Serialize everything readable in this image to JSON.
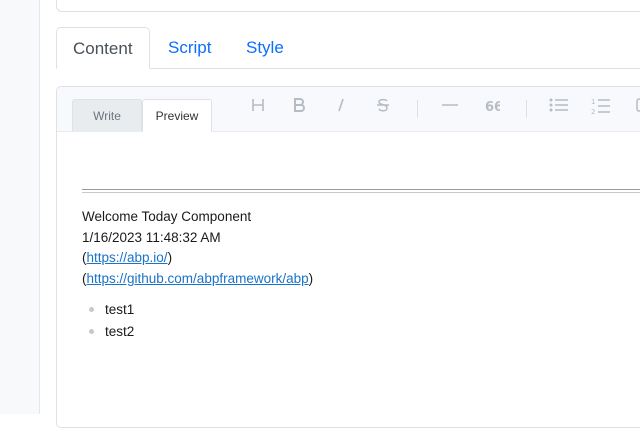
{
  "tabs": [
    {
      "label": "Content",
      "active": true
    },
    {
      "label": "Script",
      "active": false
    },
    {
      "label": "Style",
      "active": false
    }
  ],
  "editor": {
    "modes": [
      {
        "label": "Write",
        "active": false
      },
      {
        "label": "Preview",
        "active": true
      }
    ],
    "toolbar_icons": [
      "heading-icon",
      "bold-icon",
      "italic-icon",
      "strikethrough-icon",
      "horizontal-rule-icon",
      "quote-icon",
      "bullet-list-icon",
      "ordered-list-icon",
      "task-list-icon"
    ]
  },
  "preview": {
    "title": "Welcome Today Component",
    "datetime": "1/16/2023 11:48:32 AM",
    "links": [
      {
        "open": "(",
        "url": "https://abp.io/",
        "close": ")"
      },
      {
        "open": "(",
        "url": "https://github.com/abpframework/abp",
        "close": ")"
      }
    ],
    "list_items": [
      "test1",
      "test2"
    ]
  },
  "colors": {
    "link": "#1a73c8",
    "tab_link": "#0d6efd",
    "toolbar_bg": "#f7f9fc"
  }
}
